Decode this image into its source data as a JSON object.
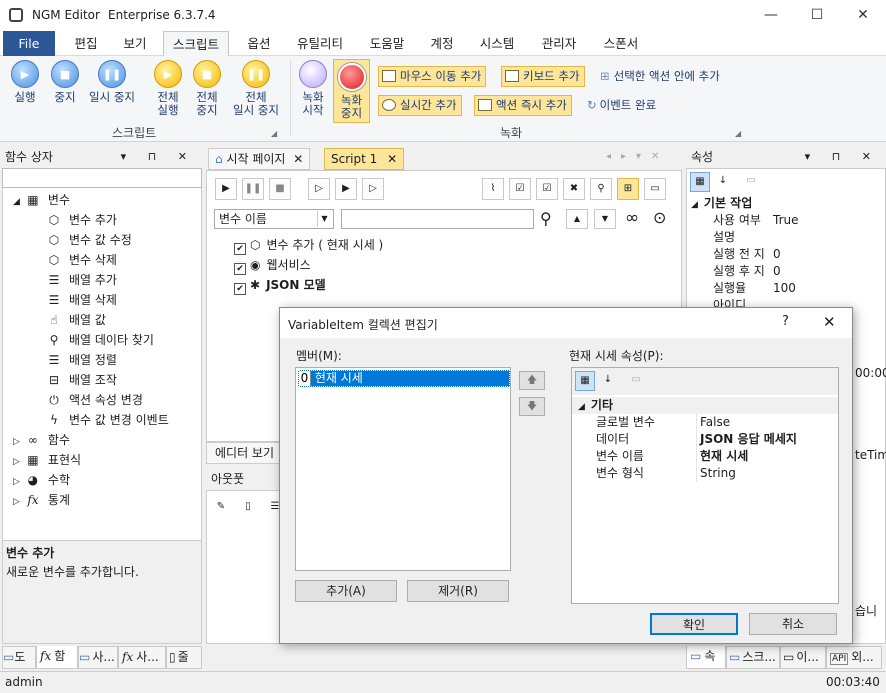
{
  "title": {
    "app": "NGM Editor",
    "edition": "Enterprise 6.3.7.4"
  },
  "window_controls": {
    "min": "—",
    "max": "☐",
    "close": "✕"
  },
  "menu": [
    "File",
    "편집",
    "보기",
    "스크립트",
    "옵션",
    "유틸리티",
    "도움말",
    "계정",
    "시스템",
    "관리자",
    "스폰서"
  ],
  "ribbon": {
    "script_group": "스크립트",
    "record_group": "녹화",
    "run": "실행",
    "stop": "중지",
    "pause": "일시 중지",
    "all_run": [
      "전체",
      "실행"
    ],
    "all_stop": [
      "전체",
      "중지"
    ],
    "all_pause": [
      "전체",
      "일시 중지"
    ],
    "rec_start": [
      "녹화",
      "시작"
    ],
    "rec_stop": [
      "녹화",
      "중지"
    ],
    "mouse_move": "마우스 이동 추가",
    "keyboard": "키보드 추가",
    "inside_action": "선택한 액션 안에 추가",
    "realtime": "실시간 추가",
    "immediate": "액션 즉시 추가",
    "event_done": "이벤트 완료"
  },
  "left_panel": {
    "title": "함수 상자",
    "tree": [
      {
        "label": "변수",
        "icon": "variable-group-icon",
        "level": 0,
        "expanded": true
      },
      {
        "label": "변수 추가",
        "icon": "cube-icon",
        "level": 1
      },
      {
        "label": "변수 값 수정",
        "icon": "cube-icon",
        "level": 1
      },
      {
        "label": "변수 삭제",
        "icon": "cube-icon",
        "level": 1
      },
      {
        "label": "배열 추가",
        "icon": "database-icon",
        "level": 1
      },
      {
        "label": "배열 삭제",
        "icon": "database-icon",
        "level": 1
      },
      {
        "label": "배열 값",
        "icon": "pointer-icon",
        "level": 1
      },
      {
        "label": "배열 데이타 찾기",
        "icon": "search-icon",
        "level": 1
      },
      {
        "label": "배열 정렬",
        "icon": "database-icon",
        "level": 1
      },
      {
        "label": "배열 조작",
        "icon": "toggle-icon",
        "level": 1
      },
      {
        "label": "액션 속성 변경",
        "icon": "power-icon",
        "level": 1
      },
      {
        "label": "변수 값 변경 이벤트",
        "icon": "bolt-icon",
        "level": 1
      },
      {
        "label": "함수",
        "icon": "infinity-icon",
        "level": 0
      },
      {
        "label": "표현식",
        "icon": "grid-icon",
        "level": 0
      },
      {
        "label": "수학",
        "icon": "pie-icon",
        "level": 0
      },
      {
        "label": "통계",
        "icon": "fx-icon",
        "level": 0
      }
    ],
    "desc_title": "변수 추가",
    "desc_text": "새로운 변수를 추가합니다.",
    "tabs": [
      "도",
      "함",
      "사...",
      "사...",
      "줄"
    ]
  },
  "doc_tabs": {
    "start": "시작 페이지",
    "script": "Script 1"
  },
  "script": {
    "var_select": "변수 이름",
    "items": [
      {
        "label": "변수 추가 ( 현재 시세 )",
        "bold": false
      },
      {
        "label": "웹서비스",
        "bold": false
      },
      {
        "label": "JSON 모델",
        "bold": true
      }
    ],
    "editor_view": "에디터 보기"
  },
  "output": {
    "title": "아웃풋"
  },
  "right_panel": {
    "title": "속성",
    "category": "기본 작업",
    "rows": [
      {
        "name": "사용 여부",
        "value": "True"
      },
      {
        "name": "설명",
        "value": ""
      },
      {
        "name": "실행 전 지",
        "value": "0"
      },
      {
        "name": "실행 후 지",
        "value": "0"
      },
      {
        "name": "실행율",
        "value": "100"
      },
      {
        "name": "아이디",
        "value": ""
      }
    ],
    "partial_a": "00:00",
    "partial_b": "teTim",
    "partial_c": "습니",
    "tabs": [
      "속",
      "스크...",
      "이...",
      "외..."
    ]
  },
  "dialog": {
    "title": "VariableItem 컬렉션 편집기",
    "help": "?",
    "close": "✕",
    "members_label": "멤버(M):",
    "members": [
      {
        "index": "0",
        "name": "현재 시세"
      }
    ],
    "props_label": "현재 시세 속성(P):",
    "category": "기타",
    "props": [
      {
        "name": "글로벌 변수",
        "value": "False",
        "bold": false
      },
      {
        "name": "데이터",
        "value": "JSON 응답 메세지",
        "bold": true
      },
      {
        "name": "변수 이름",
        "value": "현재 시세",
        "bold": true
      },
      {
        "name": "변수 형식",
        "value": "String",
        "bold": false
      }
    ],
    "add": "추가(A)",
    "remove": "제거(R)",
    "ok": "확인",
    "cancel": "취소"
  },
  "status": {
    "user": "admin",
    "time": "00:03:40"
  }
}
